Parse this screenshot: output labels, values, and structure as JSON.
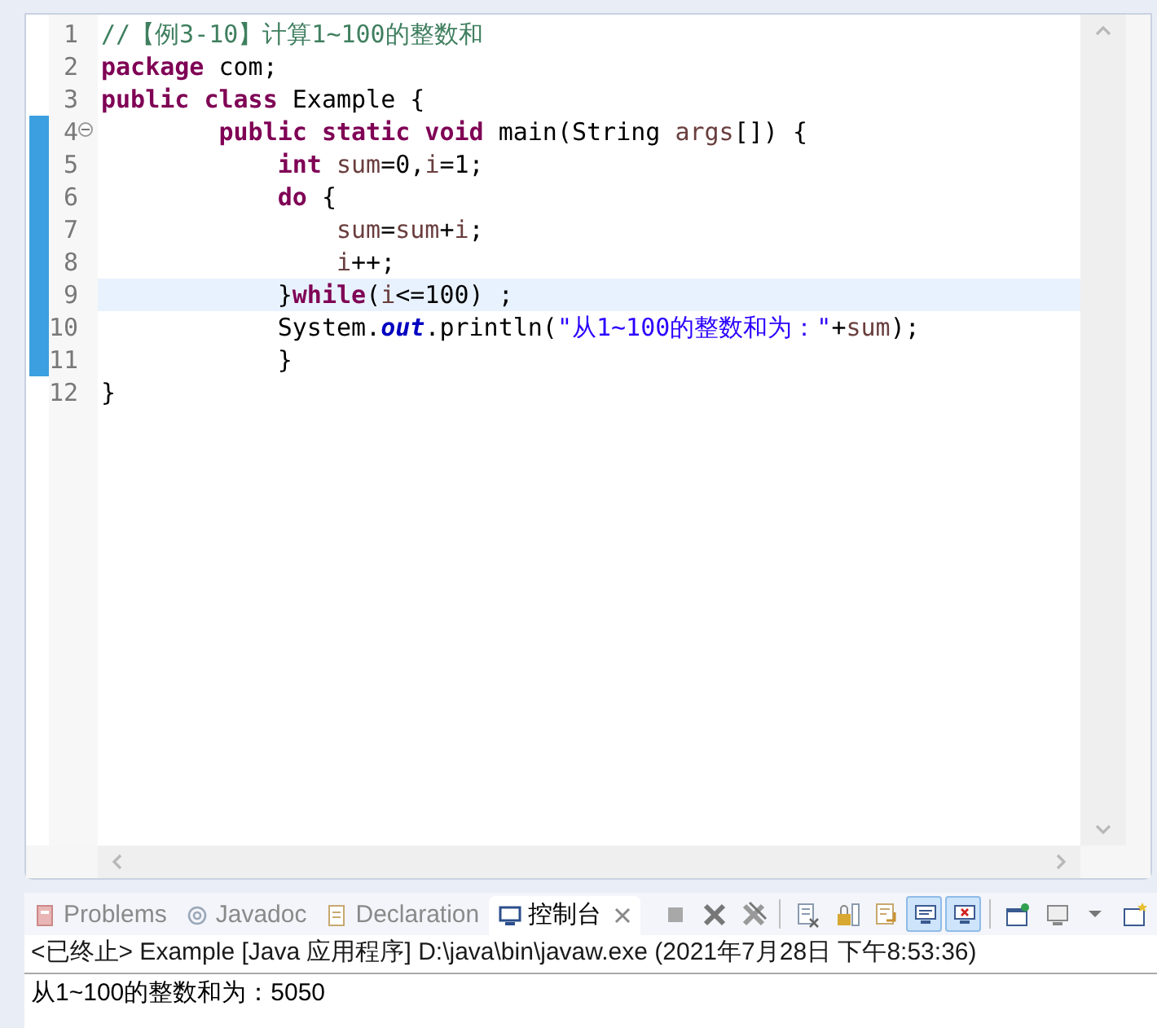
{
  "editor": {
    "lines": [
      {
        "number": "1",
        "tokens": [
          {
            "kind": "comment",
            "text": "//【例3-10】计算1~100的整数和"
          }
        ]
      },
      {
        "number": "2",
        "tokens": [
          {
            "kind": "keyword",
            "text": "package"
          },
          {
            "kind": "plain",
            "text": " com;"
          }
        ]
      },
      {
        "number": "3",
        "tokens": [
          {
            "kind": "keyword",
            "text": "public"
          },
          {
            "kind": "keyword",
            "text": " class"
          },
          {
            "kind": "plain",
            "text": " Example {"
          }
        ]
      },
      {
        "number": "4",
        "foldable": true,
        "changed": true,
        "tokens": [
          {
            "kind": "keyword",
            "text": "        public"
          },
          {
            "kind": "keyword",
            "text": " static"
          },
          {
            "kind": "keyword",
            "text": " void"
          },
          {
            "kind": "plain",
            "text": " main(String"
          },
          {
            "kind": "variable",
            "text": " args"
          },
          {
            "kind": "plain",
            "text": "[]) {"
          }
        ]
      },
      {
        "number": "5",
        "changed": true,
        "tokens": [
          {
            "kind": "keyword",
            "text": "            int"
          },
          {
            "kind": "variable",
            "text": " sum"
          },
          {
            "kind": "plain",
            "text": "=0,"
          },
          {
            "kind": "variable",
            "text": "i"
          },
          {
            "kind": "plain",
            "text": "=1;"
          }
        ]
      },
      {
        "number": "6",
        "changed": true,
        "tokens": [
          {
            "kind": "keyword",
            "text": "            do"
          },
          {
            "kind": "plain",
            "text": " {"
          }
        ]
      },
      {
        "number": "7",
        "changed": true,
        "tokens": [
          {
            "kind": "variable",
            "text": "                sum"
          },
          {
            "kind": "plain",
            "text": "="
          },
          {
            "kind": "variable",
            "text": "sum"
          },
          {
            "kind": "plain",
            "text": "+"
          },
          {
            "kind": "variable",
            "text": "i"
          },
          {
            "kind": "plain",
            "text": ";"
          }
        ]
      },
      {
        "number": "8",
        "changed": true,
        "tokens": [
          {
            "kind": "variable",
            "text": "                i"
          },
          {
            "kind": "plain",
            "text": "++;"
          }
        ]
      },
      {
        "number": "9",
        "changed": true,
        "selected": true,
        "tokens": [
          {
            "kind": "plain",
            "text": "            }"
          },
          {
            "kind": "keyword",
            "text": "while"
          },
          {
            "kind": "plain",
            "text": "("
          },
          {
            "kind": "variable",
            "text": "i"
          },
          {
            "kind": "plain",
            "text": "<=100) ;"
          }
        ]
      },
      {
        "number": "10",
        "changed": true,
        "tokens": [
          {
            "kind": "plain",
            "text": "            System."
          },
          {
            "kind": "field",
            "text": "out"
          },
          {
            "kind": "plain",
            "text": ".println("
          },
          {
            "kind": "string",
            "text": "\"从1~100的整数和为：\""
          },
          {
            "kind": "plain",
            "text": "+"
          },
          {
            "kind": "variable",
            "text": "sum"
          },
          {
            "kind": "plain",
            "text": ");"
          }
        ]
      },
      {
        "number": "11",
        "changed": true,
        "tokens": [
          {
            "kind": "plain",
            "text": "            }"
          }
        ]
      },
      {
        "number": "12",
        "tokens": [
          {
            "kind": "plain",
            "text": "}"
          }
        ]
      }
    ]
  },
  "panel": {
    "tabs": [
      {
        "label": "Problems",
        "selected": false
      },
      {
        "label": "Javadoc",
        "selected": false
      },
      {
        "label": "Declaration",
        "selected": false
      },
      {
        "label": "控制台",
        "selected": true
      }
    ],
    "toolbar": [
      {
        "kind": "stop",
        "selected": false
      },
      {
        "kind": "remove",
        "selected": false
      },
      {
        "kind": "remove-all",
        "selected": false
      },
      {
        "kind": "separator"
      },
      {
        "kind": "clear",
        "selected": false
      },
      {
        "kind": "lock",
        "selected": false
      },
      {
        "kind": "wrap",
        "selected": false
      },
      {
        "kind": "show-out",
        "selected": true
      },
      {
        "kind": "show-err",
        "selected": true
      },
      {
        "kind": "separator"
      },
      {
        "kind": "pin",
        "selected": false
      },
      {
        "kind": "display",
        "selected": false
      },
      {
        "kind": "caret",
        "selected": false
      },
      {
        "kind": "new-console",
        "selected": false
      }
    ],
    "console_header": "<已终止> Example [Java 应用程序] D:\\java\\bin\\javaw.exe  (2021年7月28日 下午8:53:36)",
    "output": "从1~100的整数和为：5050"
  }
}
